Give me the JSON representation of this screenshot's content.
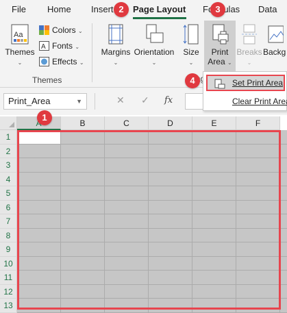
{
  "tabs": [
    {
      "label": "File"
    },
    {
      "label": "Home"
    },
    {
      "label": "Insert"
    },
    {
      "label": "Page Layout",
      "active": true
    },
    {
      "label": "Formulas"
    },
    {
      "label": "Data"
    }
  ],
  "ribbon": {
    "themes": {
      "themes_label": "Themes",
      "colors_label": "Colors",
      "fonts_label": "Fonts",
      "effects_label": "Effects",
      "group_label": "Themes"
    },
    "page_setup": {
      "margins_label": "Margins",
      "orientation_label": "Orientation",
      "size_label": "Size",
      "print_area_line1": "Print",
      "print_area_line2": "Area",
      "breaks_label": "Breaks",
      "background_label": "Backg",
      "group_label_fragment": "ag"
    }
  },
  "print_area_menu": {
    "items": [
      {
        "label": "Set Print Area"
      },
      {
        "label": "Clear Print Area"
      }
    ]
  },
  "formula_bar": {
    "name_box_value": "Print_Area",
    "cancel_icon": "✕",
    "enter_icon": "✓",
    "fx_label": "fx"
  },
  "sheet": {
    "columns": [
      "A",
      "B",
      "C",
      "D",
      "E",
      "F"
    ],
    "rows": [
      "1",
      "2",
      "3",
      "4",
      "5",
      "6",
      "7",
      "8",
      "9",
      "10",
      "11",
      "12",
      "13"
    ],
    "active_cell": "A1"
  },
  "callouts": [
    {
      "number": "1"
    },
    {
      "number": "2"
    },
    {
      "number": "3"
    },
    {
      "number": "4"
    }
  ],
  "colors": {
    "accent_green": "#217346",
    "callout_red": "#e0393f",
    "highlight_red": "#e8454e"
  }
}
